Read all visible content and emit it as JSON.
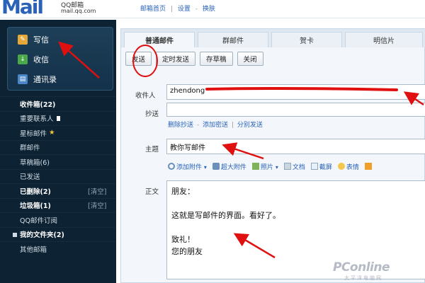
{
  "header": {
    "logo": "Mail",
    "logo_sub": "QQ邮箱",
    "logo_url": "mail.qq.com",
    "nav": [
      "邮箱首页",
      "设置",
      "换肤"
    ]
  },
  "sidebar": {
    "quick": [
      {
        "label": "写信",
        "icon": "pencil-icon"
      },
      {
        "label": "收信",
        "icon": "inbox-down-icon"
      },
      {
        "label": "通讯录",
        "icon": "contacts-icon"
      }
    ],
    "folders": [
      {
        "label": "收件箱(22)",
        "bold": true
      },
      {
        "label": "重要联系人",
        "badge": "flag"
      },
      {
        "label": "星标邮件",
        "badge": "star"
      },
      {
        "label": "群邮件"
      },
      {
        "label": "草稿箱(6)"
      },
      {
        "label": "已发送"
      },
      {
        "label": "已删除(2)",
        "bold": true,
        "action": "[清空]"
      },
      {
        "label": "垃圾箱(1)",
        "bold": true,
        "action": "[清空]"
      },
      {
        "label": "QQ邮件订阅"
      },
      {
        "label": "我的文件夹(2)",
        "bold": true,
        "square": true
      },
      {
        "label": "其他邮箱"
      }
    ]
  },
  "compose": {
    "tabs": [
      "普通邮件",
      "群邮件",
      "贺卡",
      "明信片"
    ],
    "toolbar": {
      "send": "发送",
      "timed_send": "定时发送",
      "save_draft": "存草稿",
      "close": "关闭"
    },
    "to_label": "收件人",
    "to_value": "zhendong",
    "cc_label": "抄送",
    "cc_value": "",
    "links": [
      "删除抄送",
      "添加密送",
      "分别发送"
    ],
    "subject_label": "主题",
    "subject_value": "教你写邮件",
    "attach_tools": [
      {
        "label": "添加附件",
        "icon": "paperclip-icon"
      },
      {
        "label": "超大附件",
        "icon": "large-attachment-icon"
      },
      {
        "label": "照片",
        "icon": "photo-icon"
      },
      {
        "label": "文档",
        "icon": "document-icon"
      },
      {
        "label": "截屏",
        "icon": "screenshot-icon"
      },
      {
        "label": "表情",
        "icon": "emoji-icon"
      }
    ],
    "body_label": "正文",
    "body_text": "朋友：\n\n这就是写邮件的界面。看好了。\n\n致礼！\n您的朋友"
  },
  "watermark": {
    "main": "PConline",
    "sub": "太平洋电脑网"
  },
  "colors": {
    "sidebar_bg": "#0d2232",
    "accent": "#2a62b8",
    "annotation_red": "#e01010"
  }
}
